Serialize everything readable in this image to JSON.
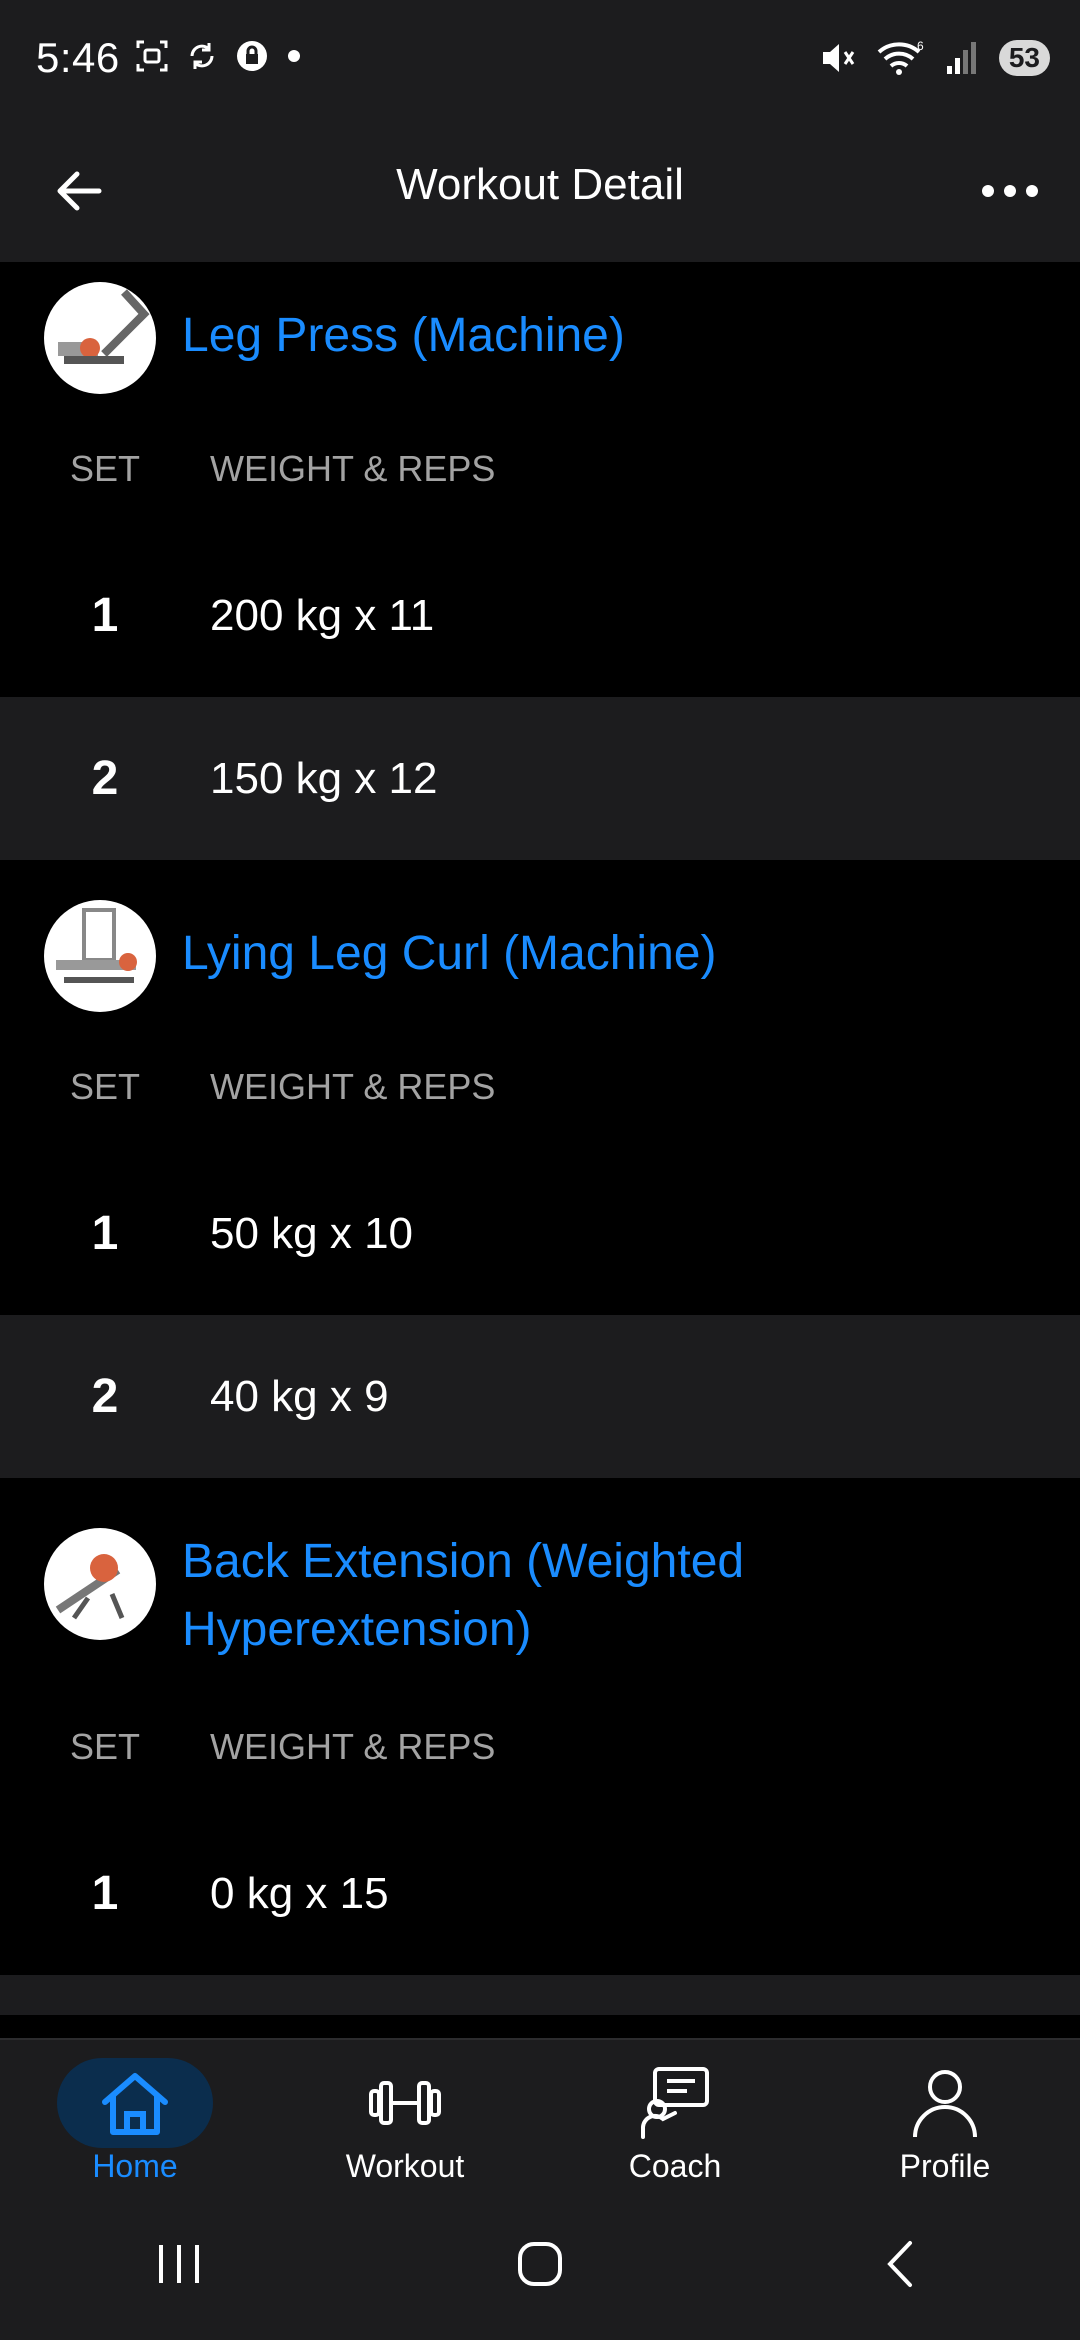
{
  "status_bar": {
    "time": "5:46",
    "battery": "53",
    "wifi_badge": "6"
  },
  "app_bar": {
    "title": "Workout Detail"
  },
  "columns": {
    "set": "SET",
    "weight_reps": "WEIGHT & REPS"
  },
  "exercises": [
    {
      "name": "Leg Press (Machine)",
      "sets": [
        {
          "num": "1",
          "value": "200 kg x 11"
        },
        {
          "num": "2",
          "value": "150 kg x 12"
        }
      ]
    },
    {
      "name": "Lying Leg Curl (Machine)",
      "sets": [
        {
          "num": "1",
          "value": "50 kg x 10"
        },
        {
          "num": "2",
          "value": "40 kg x 9"
        }
      ]
    },
    {
      "name": "Back Extension (Weighted Hyperextension)",
      "sets": [
        {
          "num": "1",
          "value": "0 kg x 15"
        }
      ]
    }
  ],
  "bottom_nav": {
    "items": [
      {
        "label": "Home",
        "icon": "home-icon",
        "active": true
      },
      {
        "label": "Workout",
        "icon": "dumbbell-icon",
        "active": false
      },
      {
        "label": "Coach",
        "icon": "coach-icon",
        "active": false
      },
      {
        "label": "Profile",
        "icon": "person-icon",
        "active": false
      }
    ]
  },
  "colors": {
    "accent": "#1a8cff",
    "surface": "#1c1c1e",
    "background": "#000000"
  }
}
